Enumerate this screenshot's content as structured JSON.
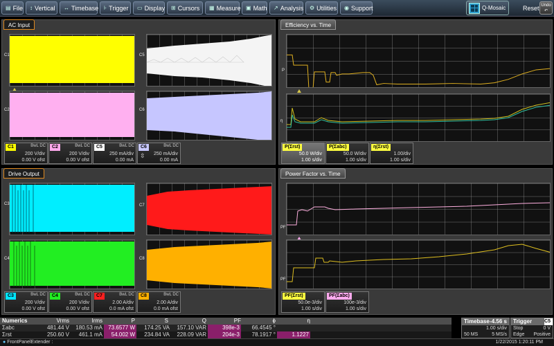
{
  "menu": {
    "items": [
      {
        "label": "File",
        "icon": "folder-icon",
        "glyph": "▤"
      },
      {
        "label": "Vertical",
        "icon": "vertical-arrows-icon",
        "glyph": "↕"
      },
      {
        "label": "Timebase",
        "icon": "horizontal-arrows-icon",
        "glyph": "↔"
      },
      {
        "label": "Trigger",
        "icon": "trigger-icon",
        "glyph": "⊦"
      },
      {
        "label": "Display",
        "icon": "display-icon",
        "glyph": "▭"
      },
      {
        "label": "Cursors",
        "icon": "cursors-icon",
        "glyph": "⊞"
      },
      {
        "label": "Measure",
        "icon": "measure-icon",
        "glyph": "▦"
      },
      {
        "label": "Math",
        "icon": "math-icon",
        "glyph": "▣"
      },
      {
        "label": "Analysis",
        "icon": "analysis-icon",
        "glyph": "↗"
      },
      {
        "label": "Utilities",
        "icon": "utilities-icon",
        "glyph": "⚙"
      },
      {
        "label": "Support",
        "icon": "support-icon",
        "glyph": "◉"
      }
    ],
    "qmosaic_label": "Q-Mosaic",
    "reset_label": "Reset",
    "undo_label": "Undo"
  },
  "panels": {
    "ac_input": {
      "title": "AC Input"
    },
    "efficiency": {
      "title": "Efficiency vs. Time"
    },
    "drive_output": {
      "title": "Drive Output"
    },
    "power_factor": {
      "title": "Power Factor vs. Time"
    }
  },
  "trace_labels": {
    "c1": "C1",
    "c2": "C2",
    "c5": "C5",
    "c6": "C6",
    "c3": "C3",
    "c4": "C4",
    "c7": "C7",
    "c8": "C8",
    "p": "P",
    "eta": "η",
    "pf": "PF"
  },
  "ac_descriptors": [
    {
      "tag": "C1",
      "color": "#ffff00",
      "bwl": "BwL DC",
      "line1": "200 V/div",
      "line2": "0.00 V ofst"
    },
    {
      "tag": "C2",
      "color": "#ffaaee",
      "bwl": "BwL DC",
      "line1": "200 V/div",
      "line2": "0.00 V ofst"
    },
    {
      "tag": "C5",
      "color": "#ffffff",
      "bwl": "BwL DC",
      "line1": "250 mA/div",
      "line2": "0.00 mA"
    },
    {
      "tag": "C6",
      "color": "#c8c8ff",
      "bwl": "BwL DC",
      "line1": "250 mA/div",
      "line2": "0.00 mA"
    }
  ],
  "drive_descriptors": [
    {
      "tag": "C3",
      "color": "#00e5ff",
      "bwl": "BwL DC",
      "line1": "200 V/div",
      "line2": "0.00 V ofst"
    },
    {
      "tag": "C4",
      "color": "#22ee22",
      "bwl": "BwL DC",
      "line1": "200 V/div",
      "line2": "0.00 V ofst"
    },
    {
      "tag": "C7",
      "color": "#ff2020",
      "bwl": "BwL DC",
      "line1": "2.00 A/div",
      "line2": "0.0 mA ofst"
    },
    {
      "tag": "C8",
      "color": "#ffb000",
      "bwl": "BwL DC",
      "line1": "2.00 A/div",
      "line2": "0.0 mA ofst"
    }
  ],
  "eff_descriptors": [
    {
      "tag": "P(Σrst)",
      "color": "#ffff40",
      "line1": "50.0 W/div",
      "line2": "1.00 s/div",
      "active": true
    },
    {
      "tag": "P(Σabc)",
      "color": "#ffff40",
      "line1": "50.0 W/div",
      "line2": "1.00 s/div",
      "active": false
    },
    {
      "tag": "η(Σrst)",
      "color": "#ffff40",
      "line1": "1.00/div",
      "line2": "1.00 s/div",
      "active": false
    }
  ],
  "pf_descriptors": [
    {
      "tag": "PF(Σrst)",
      "color": "#ffff40",
      "line1": "50.0e-3/div",
      "line2": "1.00 s/div"
    },
    {
      "tag": "PF(Σabc)",
      "color": "#ffaaee",
      "line1": "100e-3/div",
      "line2": "1.00 s/div"
    }
  ],
  "numerics": {
    "headers": [
      "Numerics",
      "Vrms",
      "Irms",
      "P",
      "S",
      "Q",
      "PF",
      "ϕ",
      "η"
    ],
    "rows": [
      {
        "label": "Σabc",
        "vrms": "481.44 V",
        "irms": "180.53 mA",
        "p": "73.6577 W",
        "s": "174.25 VA",
        "q": "157.10 VAR",
        "pf": "398e-3",
        "phi": "66.4545 °",
        "eta": ""
      },
      {
        "label": "Σrst",
        "vrms": "250.60 V",
        "irms": "461.1 mA",
        "p": "54.002 W",
        "s": "234.84 VA",
        "q": "228.09 VAR",
        "pf": "204e-3",
        "phi": "78.1917 °",
        "eta": "1.1227"
      }
    ]
  },
  "timebase": {
    "title": "Timebase",
    "value": "-4.56 s",
    "r1a": "",
    "r1b": "1.00 s/div",
    "r2a": "50 MS",
    "r2b": "5 MS/s"
  },
  "trigger": {
    "title": "Trigger",
    "ch": "C5",
    "r1a": "Stop",
    "r1b": "0 V",
    "r2a": "Edge",
    "r2b": "Positive"
  },
  "status": {
    "app": "FrontPanelExtender :",
    "datetime": "1/22/2015 1:20:11 PM"
  }
}
